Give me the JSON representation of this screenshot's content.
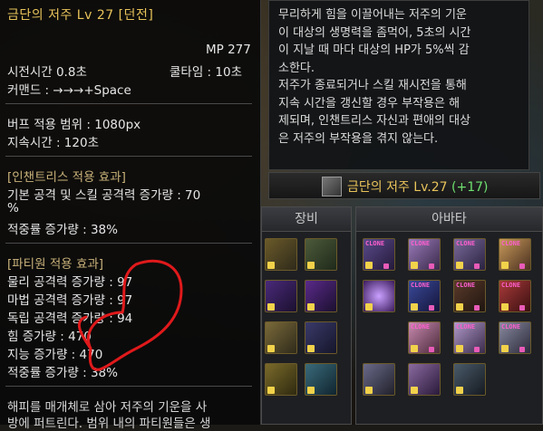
{
  "left_tooltip": {
    "title": "금단의 저주 Lv 27 [던전]",
    "mp": "MP 277",
    "cast_time": "시전시간 0.8초",
    "cooldown": "쿨타임 : 10초",
    "command": "커맨드 : →→→+Space",
    "buff_range": "버프 적용 범위 : 1080px",
    "duration": "지속시간 : 120초",
    "enchantress_header": "[인챈트리스 적용 효과]",
    "enchantress_line1": "기본 공격 및 스킬 공격력 증가량 : 70",
    "enchantress_line2": "%",
    "enchantress_line3": "적중률 증가량 : 38%",
    "party_header": "[파티원 적용 효과]",
    "party_lines": [
      "물리 공격력 증가량 : 97",
      "마법 공격력 증가량 : 97",
      "독립 공격력 증가량 : 94",
      "힘 증가량 : 470",
      "지능 증가량 : 470",
      "적중률 증가량 : 38%"
    ],
    "footer_line1": "해피를 매개체로 삼아 저주의 기운을 사",
    "footer_line2": "방에 퍼트린다. 범위 내의 파티원들은 생"
  },
  "right_tooltip": {
    "lines": [
      "무리하게 힘을 이끌어내는 저주의 기운",
      "이 대상의 생명력을 좀먹어, 5초의 시간",
      "이 지날 때 마다 대상의 HP가 5%씩 감",
      "소한다.",
      "저주가 종료되거나 스킬 재시전을 통해",
      "지속 시간을 갱신할 경우 부작용은 해",
      "제되며, 인챈트리스 자신과 편애의 대상",
      "은 저주의 부작용을 겪지 않는다."
    ]
  },
  "skill_bar": {
    "name": "금단의 저주 Lv.27",
    "bonus": "(+17)"
  },
  "equipment_panel": {
    "title": "장비"
  },
  "avatar_panel": {
    "title": "아바타"
  },
  "clone_label": "CLONE",
  "colors": {
    "title_gold": "#e8c35a",
    "bonus_green": "#6ee06e",
    "annotation_red": "#e0191b"
  }
}
